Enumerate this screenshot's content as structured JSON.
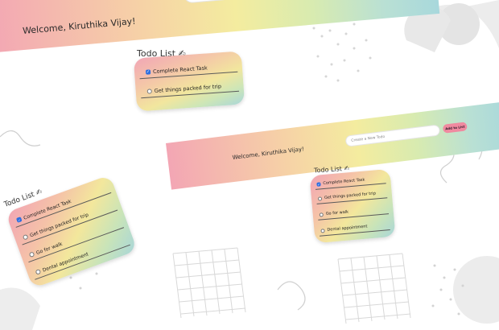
{
  "app": {
    "welcome": "Welcome, Kiruthika Vijay!",
    "input_placeholder": "Create a New Todo",
    "add_button": "Add to List",
    "list_title": "Todo List",
    "title_icon": "writing-hand-icon",
    "todos": [
      {
        "label": "Complete React Task",
        "checked": true
      },
      {
        "label": "Get things packed for trip",
        "checked": false
      },
      {
        "label": "Go for walk",
        "checked": false
      },
      {
        "label": "Dental appointment",
        "checked": false
      }
    ]
  }
}
